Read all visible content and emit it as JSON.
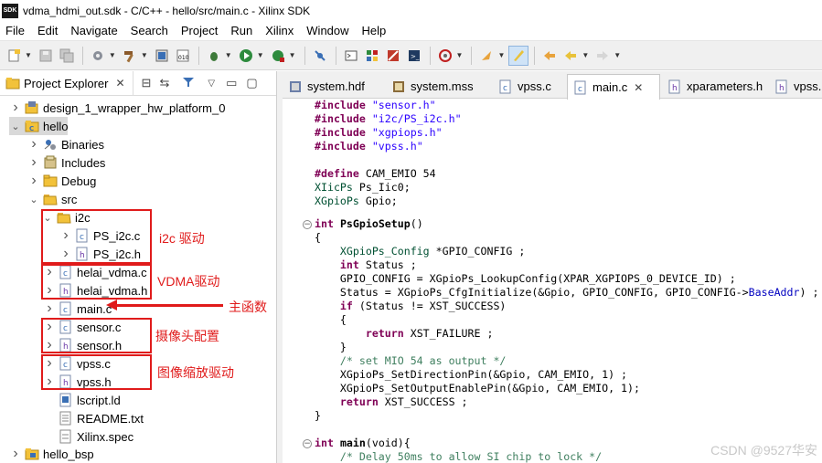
{
  "window": {
    "title": "vdma_hdmi_out.sdk - C/C++ - hello/src/main.c - Xilinx SDK",
    "icon_text": "SDK"
  },
  "menu": [
    "File",
    "Edit",
    "Navigate",
    "Search",
    "Project",
    "Run",
    "Xilinx",
    "Window",
    "Help"
  ],
  "project_explorer": {
    "title": "Project Explorer",
    "tree": [
      {
        "label": "design_1_wrapper_hw_platform_0",
        "icon": "hw-platform-icon",
        "arrow": ">"
      },
      {
        "label": "hello",
        "icon": "project-folder-icon",
        "arrow": "v"
      },
      {
        "label": "Binaries",
        "icon": "binaries-icon",
        "arrow": ">"
      },
      {
        "label": "Includes",
        "icon": "includes-icon",
        "arrow": ">"
      },
      {
        "label": "Debug",
        "icon": "folder-icon",
        "arrow": ">"
      },
      {
        "label": "src",
        "icon": "folder-open-icon",
        "arrow": "v"
      },
      {
        "label": "i2c",
        "icon": "folder-open-icon",
        "arrow": "v"
      },
      {
        "label": "PS_i2c.c",
        "icon": "c-file-icon",
        "arrow": ">"
      },
      {
        "label": "PS_i2c.h",
        "icon": "h-file-icon",
        "arrow": ">"
      },
      {
        "label": "helai_vdma.c",
        "icon": "c-file-icon",
        "arrow": ">"
      },
      {
        "label": "helai_vdma.h",
        "icon": "h-file-icon",
        "arrow": ">"
      },
      {
        "label": "main.c",
        "icon": "c-file-icon",
        "arrow": ">"
      },
      {
        "label": "sensor.c",
        "icon": "c-file-icon",
        "arrow": ">"
      },
      {
        "label": "sensor.h",
        "icon": "h-file-icon",
        "arrow": ">"
      },
      {
        "label": "vpss.c",
        "icon": "c-file-icon",
        "arrow": ">"
      },
      {
        "label": "vpss.h",
        "icon": "h-file-icon",
        "arrow": ">"
      },
      {
        "label": "lscript.ld",
        "icon": "linker-script-icon",
        "arrow": ""
      },
      {
        "label": "README.txt",
        "icon": "text-file-icon",
        "arrow": ""
      },
      {
        "label": "Xilinx.spec",
        "icon": "spec-file-icon",
        "arrow": ""
      },
      {
        "label": "hello_bsp",
        "icon": "bsp-icon",
        "arrow": ">"
      }
    ]
  },
  "annotations": {
    "i2c": "i2c 驱动",
    "vdma": "VDMA驱动",
    "main": "主函数",
    "sensor": "摄像头配置",
    "vpss": "图像缩放驱动"
  },
  "editor_tabs": [
    {
      "label": "system.hdf",
      "icon": "hdf-file-icon",
      "active": false
    },
    {
      "label": "system.mss",
      "icon": "mss-file-icon",
      "active": false
    },
    {
      "label": "vpss.c",
      "icon": "c-file-icon",
      "active": false
    },
    {
      "label": "main.c",
      "icon": "c-file-icon",
      "active": true
    },
    {
      "label": "xparameters.h",
      "icon": "h-file-icon",
      "active": false
    },
    {
      "label": "vpss.h",
      "icon": "h-file-icon",
      "active": false
    }
  ],
  "code": {
    "l1_kw": "#include",
    "l1_str": "\"sensor.h\"",
    "l2_kw": "#include",
    "l2_str": "\"i2c/PS_i2c.h\"",
    "l3_kw": "#include",
    "l3_str": "\"xgpiops.h\"",
    "l4_kw": "#include",
    "l4_str": "\"vpss.h\"",
    "l6_kw": "#define",
    "l6_rest": " CAM_EMIO 54",
    "l7_ty": "XIicPs",
    "l7_rest": " Ps_Iic0;",
    "l8_ty": "XGpioPs",
    "l8_rest": " Gpio;",
    "l10_kw": "int",
    "l10_fn": "PsGpioSetup",
    "l10_rest": "()",
    "l11": "{",
    "l12_ty": "XGpioPs_Config",
    "l12_rest": " *GPIO_CONFIG ;",
    "l13_kw": "int",
    "l13_rest": " Status ;",
    "l14": "GPIO_CONFIG = XGpioPs_LookupConfig(XPAR_XGPIOPS_0_DEVICE_ID) ;",
    "l15_a": "Status = XGpioPs_CfgInitialize(&Gpio, GPIO_CONFIG, GPIO_CONFIG->",
    "l15_fld": "BaseAddr",
    "l15_b": ") ;",
    "l16_kw": "if",
    "l16_rest": " (Status != XST_SUCCESS)",
    "l17": "{",
    "l18_kw": "return",
    "l18_rest": " XST_FAILURE ;",
    "l19": "}",
    "l20_cm": "/* set MIO 54 as output */",
    "l21": "XGpioPs_SetDirectionPin(&Gpio, CAM_EMIO, 1) ;",
    "l22": "XGpioPs_SetOutputEnablePin(&Gpio, CAM_EMIO, 1);",
    "l23_kw": "return",
    "l23_rest": " XST_SUCCESS ;",
    "l24": "}",
    "l26_kw": "int",
    "l26_fn": "main",
    "l26_rest": "(void){",
    "l27_cm": "/* Delay 50ms to allow SI chip to lock */"
  },
  "watermark": "CSDN @9527华安"
}
